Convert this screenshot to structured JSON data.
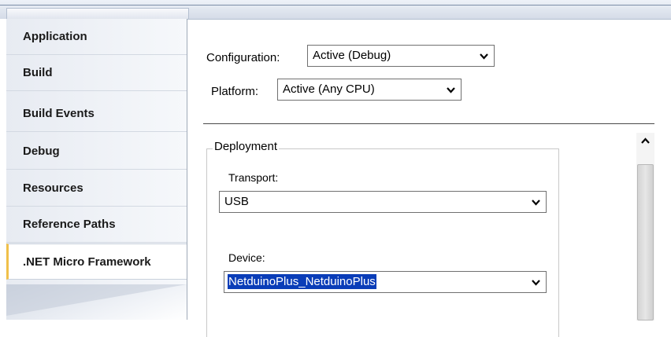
{
  "sidebar": {
    "items": [
      {
        "label": "Application"
      },
      {
        "label": "Build"
      },
      {
        "label": "Build Events"
      },
      {
        "label": "Debug"
      },
      {
        "label": "Resources"
      },
      {
        "label": "Reference Paths"
      },
      {
        "label": ".NET Micro Framework",
        "active": true
      }
    ]
  },
  "config": {
    "configuration_label": "Configuration:",
    "configuration_value": "Active (Debug)",
    "platform_label": "Platform:",
    "platform_value": "Active (Any CPU)"
  },
  "deployment": {
    "title": "Deployment",
    "transport_label": "Transport:",
    "transport_value": "USB",
    "device_label": "Device:",
    "device_value": "NetduinoPlus_NetduinoPlus"
  },
  "icons": {
    "dropdown": "chevron-down-icon",
    "scroll_up": "chevron-up-icon"
  },
  "colors": {
    "selection": "#0a3db8",
    "active_tab_marker": "#f0c04a"
  }
}
